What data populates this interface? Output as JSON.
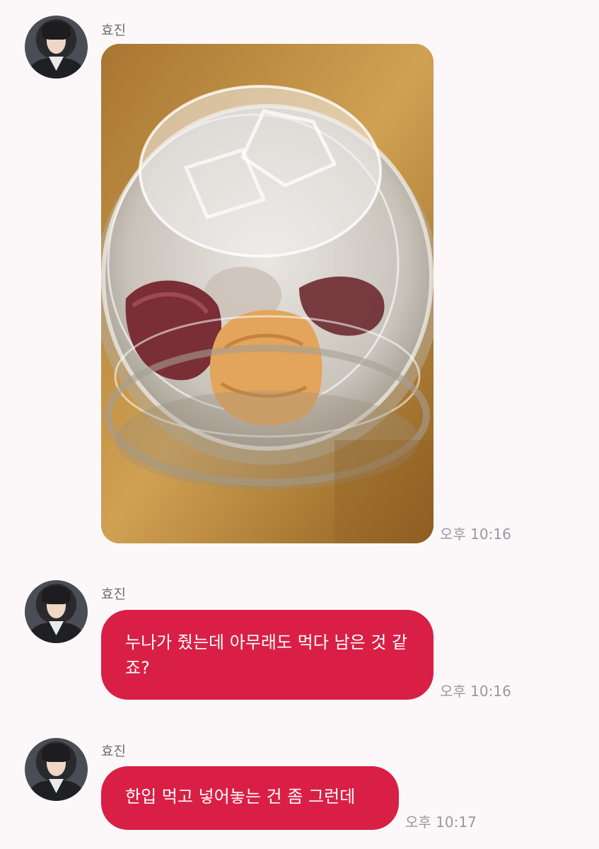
{
  "messages": [
    {
      "sender": "효진",
      "type": "image",
      "image_description": "photo",
      "time": "오후 10:16"
    },
    {
      "sender": "효진",
      "type": "text",
      "text": "누나가 줬는데 아무래도 먹다 남은 것 같죠?",
      "time": "오후 10:16"
    },
    {
      "sender": "효진",
      "type": "text",
      "text": "한입 먹고 넣어놓는 건 좀 그런데",
      "time": "오후 10:17"
    }
  ],
  "colors": {
    "background": "#fcf8fa",
    "bubble": "#d91f45",
    "bubble_text": "#ffffff",
    "sender_name": "#6d6a6e",
    "timestamp": "#9b969b"
  },
  "icons": {
    "avatar": "profile-photo"
  }
}
